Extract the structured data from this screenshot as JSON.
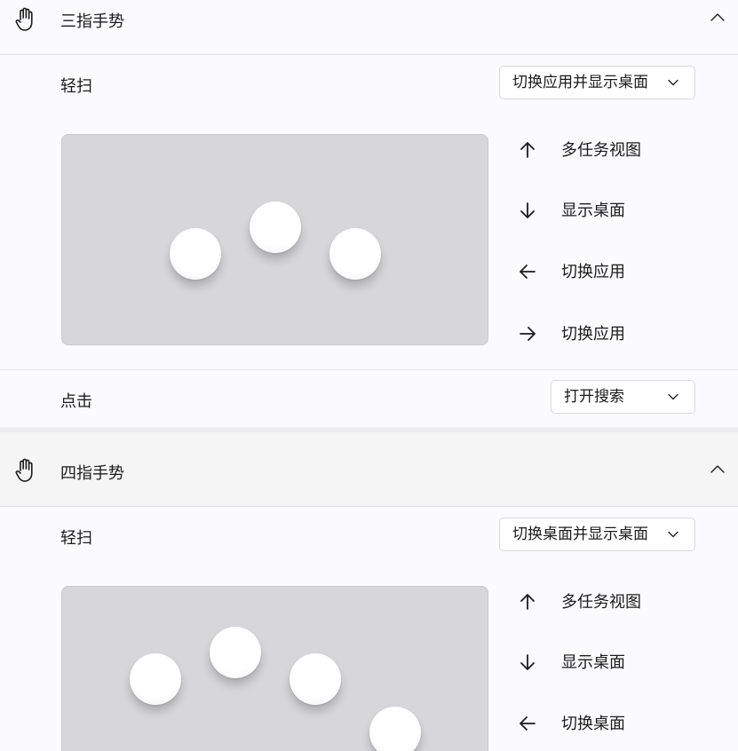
{
  "three_finger": {
    "title": "三指手势",
    "swipe_label": "轻扫",
    "swipe_value": "切换应用并显示桌面",
    "directions": [
      {
        "arrow": "up-arrow-icon",
        "label": "多任务视图"
      },
      {
        "arrow": "down-arrow-icon",
        "label": "显示桌面"
      },
      {
        "arrow": "left-arrow-icon",
        "label": "切换应用"
      },
      {
        "arrow": "right-arrow-icon",
        "label": "切换应用"
      }
    ],
    "tap_label": "点击",
    "tap_value": "打开搜索"
  },
  "four_finger": {
    "title": "四指手势",
    "swipe_label": "轻扫",
    "swipe_value": "切换桌面并显示桌面",
    "directions": [
      {
        "arrow": "up-arrow-icon",
        "label": "多任务视图"
      },
      {
        "arrow": "down-arrow-icon",
        "label": "显示桌面"
      },
      {
        "arrow": "left-arrow-icon",
        "label": "切换桌面"
      }
    ]
  },
  "colors": {
    "background": "#f3f3f3",
    "card": "#fbfbfd",
    "touchpad": "#d7d7da",
    "text": "#1b1b1b"
  }
}
